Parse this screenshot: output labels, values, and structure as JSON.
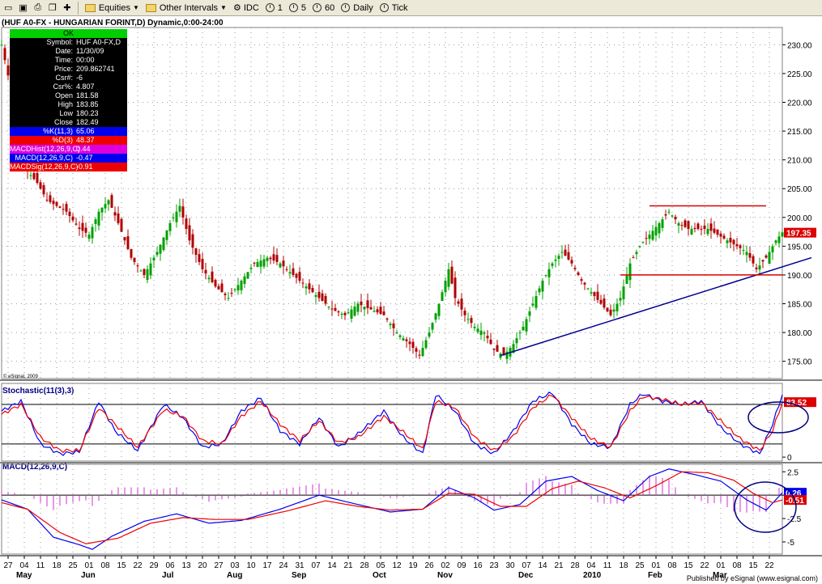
{
  "toolbar": {
    "equities_label": "Equities",
    "other_intervals_label": "Other Intervals",
    "idc_label": "IDC",
    "interval_1": "1",
    "interval_5": "5",
    "interval_60": "60",
    "interval_daily": "Daily",
    "interval_tick": "Tick"
  },
  "header": {
    "title": "(HUF A0-FX - HUNGARIAN FORINT,D) Dynamic,0:00-24:00",
    "esignal_copyright": "© eSignal, 2009",
    "published_by": "Published by eSignal (www.esignal.com)"
  },
  "data_window": {
    "ok_label": "OK",
    "rows": [
      {
        "k": "Symbol:",
        "v": "HUF A0-FX,D"
      },
      {
        "k": "Date:",
        "v": "11/30/09"
      },
      {
        "k": "Time:",
        "v": "00:00"
      },
      {
        "k": "Price:",
        "v": "209.862741"
      },
      {
        "k": "Csr#:",
        "v": "-6"
      },
      {
        "k": "Csr%:",
        "v": "4.807"
      },
      {
        "k": "Open",
        "v": "181.58"
      },
      {
        "k": "High",
        "v": "183.85"
      },
      {
        "k": "Low",
        "v": "180.23"
      },
      {
        "k": "Close",
        "v": "182.49"
      }
    ],
    "indicator_rows": [
      {
        "k": "%K(11,3)",
        "v": "65.06",
        "color": "#0000ee"
      },
      {
        "k": "%D(3)",
        "v": "48.37",
        "color": "#ee0000"
      },
      {
        "k": "MACDHist(12,26,9,C)",
        "v": "0.44",
        "color": "#dd00dd"
      },
      {
        "k": "MACD(12,26,9,C)",
        "v": "-0.47",
        "color": "#0000ee"
      },
      {
        "k": "MACDSig(12,26,9,C)",
        "v": "-0.91",
        "color": "#ee0000"
      }
    ]
  },
  "chart_data": [
    {
      "type": "candlestick",
      "title": "(HUF A0-FX - HUNGARIAN FORINT,D) Dynamic,0:00-24:00",
      "ylim": [
        172,
        233
      ],
      "y_ticks": [
        "230.00",
        "225.00",
        "220.00",
        "215.00",
        "210.00",
        "205.00",
        "200.00",
        "195.00",
        "190.00",
        "185.00",
        "180.00",
        "175.00"
      ],
      "last_price_label": "197.35",
      "close_path": [
        [
          0,
          230
        ],
        [
          3,
          222
        ],
        [
          5,
          214
        ],
        [
          8,
          208
        ],
        [
          11,
          206
        ],
        [
          14,
          203
        ],
        [
          17,
          202
        ],
        [
          20,
          201
        ],
        [
          24,
          198
        ],
        [
          27,
          197
        ],
        [
          30,
          201
        ],
        [
          33,
          203
        ],
        [
          36,
          199
        ],
        [
          40,
          193
        ],
        [
          44,
          190
        ],
        [
          48,
          194
        ],
        [
          52,
          199
        ],
        [
          55,
          202
        ],
        [
          58,
          196
        ],
        [
          62,
          191
        ],
        [
          66,
          188
        ],
        [
          70,
          186
        ],
        [
          74,
          189
        ],
        [
          78,
          192
        ],
        [
          82,
          193
        ],
        [
          86,
          192
        ],
        [
          90,
          190
        ],
        [
          94,
          188
        ],
        [
          98,
          186
        ],
        [
          102,
          184
        ],
        [
          106,
          183
        ],
        [
          110,
          185
        ],
        [
          114,
          184
        ],
        [
          118,
          183
        ],
        [
          122,
          180
        ],
        [
          126,
          178
        ],
        [
          129,
          176
        ],
        [
          132,
          180
        ],
        [
          135,
          185
        ],
        [
          138,
          191
        ],
        [
          140,
          186
        ],
        [
          143,
          183
        ],
        [
          146,
          181
        ],
        [
          149,
          180
        ],
        [
          152,
          177
        ],
        [
          155,
          176
        ],
        [
          158,
          178
        ],
        [
          161,
          181
        ],
        [
          164,
          185
        ],
        [
          167,
          189
        ],
        [
          170,
          192
        ],
        [
          173,
          194
        ],
        [
          176,
          192
        ],
        [
          179,
          189
        ],
        [
          182,
          187
        ],
        [
          185,
          185
        ],
        [
          188,
          183
        ],
        [
          191,
          186
        ],
        [
          194,
          192
        ],
        [
          197,
          195
        ],
        [
          200,
          197
        ],
        [
          203,
          199
        ],
        [
          206,
          201
        ],
        [
          209,
          199
        ],
        [
          212,
          198
        ],
        [
          215,
          198
        ],
        [
          218,
          198
        ],
        [
          221,
          197
        ],
        [
          224,
          196
        ],
        [
          227,
          195
        ],
        [
          230,
          194
        ],
        [
          233,
          191
        ],
        [
          236,
          193
        ],
        [
          239,
          196
        ],
        [
          241,
          197.4
        ]
      ],
      "trendline": [
        [
          154,
          176
        ],
        [
          250,
          193
        ]
      ],
      "resistance": {
        "y": 202,
        "from": 200,
        "to": 236
      },
      "support": {
        "y": 190,
        "from": 191,
        "to": 241
      }
    },
    {
      "type": "line",
      "title": "Stochastic(11(3),3)",
      "ylim": [
        -6,
        112
      ],
      "y_ticks": [
        "0"
      ],
      "reference_lines": [
        20,
        80
      ],
      "value_labels": [
        "83.52"
      ],
      "series": [
        {
          "name": "%K",
          "color": "#0000ee",
          "points": [
            [
              0,
              70
            ],
            [
              6,
              85
            ],
            [
              12,
              20
            ],
            [
              18,
              5
            ],
            [
              24,
              8
            ],
            [
              30,
              85
            ],
            [
              35,
              40
            ],
            [
              42,
              10
            ],
            [
              50,
              80
            ],
            [
              56,
              60
            ],
            [
              62,
              15
            ],
            [
              68,
              20
            ],
            [
              74,
              70
            ],
            [
              80,
              90
            ],
            [
              86,
              40
            ],
            [
              92,
              20
            ],
            [
              98,
              60
            ],
            [
              104,
              15
            ],
            [
              110,
              35
            ],
            [
              118,
              70
            ],
            [
              124,
              30
            ],
            [
              130,
              5
            ],
            [
              134,
              95
            ],
            [
              140,
              70
            ],
            [
              146,
              20
            ],
            [
              152,
              5
            ],
            [
              158,
              40
            ],
            [
              164,
              85
            ],
            [
              170,
              98
            ],
            [
              176,
              50
            ],
            [
              182,
              20
            ],
            [
              188,
              15
            ],
            [
              194,
              80
            ],
            [
              198,
              96
            ],
            [
              204,
              85
            ],
            [
              210,
              80
            ],
            [
              216,
              85
            ],
            [
              222,
              45
            ],
            [
              228,
              20
            ],
            [
              234,
              5
            ],
            [
              238,
              50
            ],
            [
              241,
              95
            ]
          ]
        },
        {
          "name": "%D",
          "color": "#ee0000",
          "points": [
            [
              0,
              65
            ],
            [
              6,
              80
            ],
            [
              12,
              30
            ],
            [
              18,
              10
            ],
            [
              24,
              10
            ],
            [
              30,
              75
            ],
            [
              35,
              50
            ],
            [
              42,
              15
            ],
            [
              50,
              72
            ],
            [
              56,
              62
            ],
            [
              62,
              25
            ],
            [
              68,
              20
            ],
            [
              74,
              62
            ],
            [
              80,
              85
            ],
            [
              86,
              50
            ],
            [
              92,
              25
            ],
            [
              98,
              55
            ],
            [
              104,
              22
            ],
            [
              110,
              30
            ],
            [
              118,
              62
            ],
            [
              124,
              38
            ],
            [
              130,
              12
            ],
            [
              134,
              85
            ],
            [
              140,
              75
            ],
            [
              146,
              30
            ],
            [
              152,
              10
            ],
            [
              158,
              32
            ],
            [
              164,
              75
            ],
            [
              170,
              95
            ],
            [
              176,
              60
            ],
            [
              182,
              28
            ],
            [
              188,
              15
            ],
            [
              194,
              70
            ],
            [
              198,
              92
            ],
            [
              204,
              88
            ],
            [
              210,
              80
            ],
            [
              216,
              83
            ],
            [
              222,
              55
            ],
            [
              228,
              28
            ],
            [
              234,
              10
            ],
            [
              238,
              40
            ],
            [
              241,
              83.5
            ]
          ]
        }
      ]
    },
    {
      "type": "line",
      "title": "MACD(12,26,9,C)",
      "ylim": [
        -6.3,
        3.3
      ],
      "y_ticks": [
        "2.5",
        "0",
        "-2.5",
        "-5"
      ],
      "value_labels": [
        "0.26",
        "-0.51"
      ],
      "series": [
        {
          "name": "MACD",
          "color": "#0000ee",
          "points": [
            [
              0,
              -0.5
            ],
            [
              8,
              -1.5
            ],
            [
              16,
              -4.5
            ],
            [
              24,
              -5.3
            ],
            [
              28,
              -5.8
            ],
            [
              34,
              -4.4
            ],
            [
              44,
              -2.8
            ],
            [
              54,
              -2.0
            ],
            [
              64,
              -3.0
            ],
            [
              74,
              -2.7
            ],
            [
              86,
              -1.5
            ],
            [
              98,
              0
            ],
            [
              110,
              -1.0
            ],
            [
              120,
              -1.8
            ],
            [
              130,
              -1.5
            ],
            [
              138,
              0.8
            ],
            [
              146,
              -0.3
            ],
            [
              152,
              -1.6
            ],
            [
              160,
              -1.0
            ],
            [
              168,
              1.5
            ],
            [
              176,
              2.0
            ],
            [
              184,
              0.5
            ],
            [
              192,
              -0.6
            ],
            [
              200,
              2.0
            ],
            [
              206,
              2.8
            ],
            [
              214,
              2.2
            ],
            [
              222,
              1.5
            ],
            [
              230,
              -0.5
            ],
            [
              236,
              -1.6
            ],
            [
              241,
              0.26
            ]
          ]
        },
        {
          "name": "Signal",
          "color": "#ee0000",
          "points": [
            [
              0,
              -0.8
            ],
            [
              8,
              -1.5
            ],
            [
              18,
              -4.0
            ],
            [
              26,
              -5.2
            ],
            [
              36,
              -4.6
            ],
            [
              46,
              -3.0
            ],
            [
              56,
              -2.4
            ],
            [
              66,
              -2.6
            ],
            [
              76,
              -2.6
            ],
            [
              88,
              -1.7
            ],
            [
              100,
              -0.6
            ],
            [
              110,
              -1.2
            ],
            [
              120,
              -1.6
            ],
            [
              130,
              -1.5
            ],
            [
              138,
              0.2
            ],
            [
              146,
              0.1
            ],
            [
              154,
              -1.2
            ],
            [
              162,
              -1.2
            ],
            [
              170,
              0.7
            ],
            [
              178,
              1.5
            ],
            [
              186,
              0.8
            ],
            [
              194,
              -0.3
            ],
            [
              202,
              1.0
            ],
            [
              210,
              2.5
            ],
            [
              218,
              2.4
            ],
            [
              226,
              1.6
            ],
            [
              232,
              0.2
            ],
            [
              238,
              -0.8
            ],
            [
              241,
              -0.51
            ]
          ]
        }
      ]
    }
  ],
  "x_axis": {
    "day_labels": [
      "27",
      "04",
      "11",
      "18",
      "25",
      "01",
      "08",
      "15",
      "22",
      "29",
      "06",
      "13",
      "20",
      "27",
      "03",
      "10",
      "17",
      "24",
      "31",
      "07",
      "14",
      "21",
      "28",
      "05",
      "12",
      "19",
      "26",
      "02",
      "09",
      "16",
      "23",
      "30",
      "07",
      "14",
      "21",
      "28",
      "04",
      "11",
      "18",
      "25",
      "01",
      "08",
      "15",
      "22",
      "01",
      "08",
      "15",
      "22"
    ],
    "month_labels": [
      {
        "label": "May",
        "index": 1
      },
      {
        "label": "Jun",
        "index": 5
      },
      {
        "label": "Jul",
        "index": 10
      },
      {
        "label": "Aug",
        "index": 14
      },
      {
        "label": "Sep",
        "index": 18
      },
      {
        "label": "Oct",
        "index": 23
      },
      {
        "label": "Nov",
        "index": 27
      },
      {
        "label": "Dec",
        "index": 32
      },
      {
        "label": "2010",
        "index": 36
      },
      {
        "label": "Feb",
        "index": 40
      },
      {
        "label": "Mar",
        "index": 44
      }
    ]
  }
}
